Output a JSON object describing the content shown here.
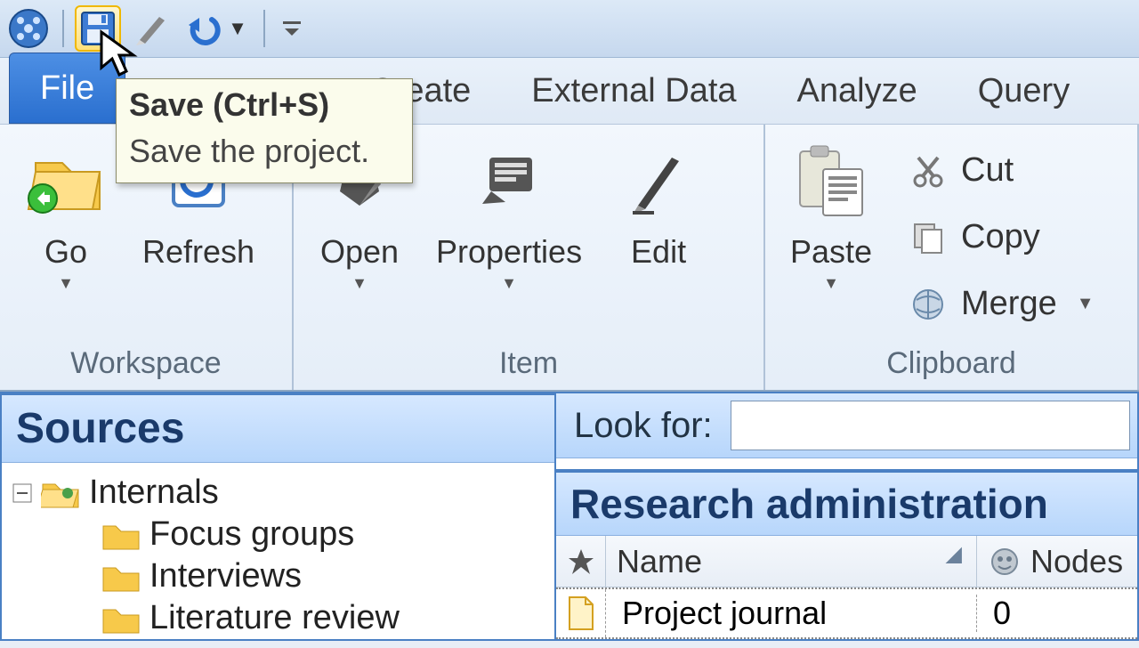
{
  "qat": {
    "undo_dropdown": "▾",
    "more": "="
  },
  "tooltip": {
    "title": "Save (Ctrl+S)",
    "body": "Save the project."
  },
  "tabs": {
    "file": "File",
    "create": "Create",
    "external": "External Data",
    "analyze": "Analyze",
    "query": "Query"
  },
  "ribbon": {
    "workspace": {
      "go": "Go",
      "refresh": "Refresh",
      "label": "Workspace"
    },
    "item": {
      "open": "Open",
      "properties": "Properties",
      "edit": "Edit",
      "label": "Item"
    },
    "clipboard": {
      "paste": "Paste",
      "cut": "Cut",
      "copy": "Copy",
      "merge": "Merge",
      "label": "Clipboard"
    }
  },
  "nav": {
    "title": "Sources",
    "root": "Internals",
    "children": [
      "Focus groups",
      "Interviews",
      "Literature review"
    ]
  },
  "main": {
    "lookfor_label": "Look for:",
    "lookfor_value": "",
    "content_title": "Research administration",
    "headers": {
      "name": "Name",
      "nodes": "Nodes"
    },
    "row": {
      "name": "Project journal",
      "nodes": "0"
    }
  }
}
